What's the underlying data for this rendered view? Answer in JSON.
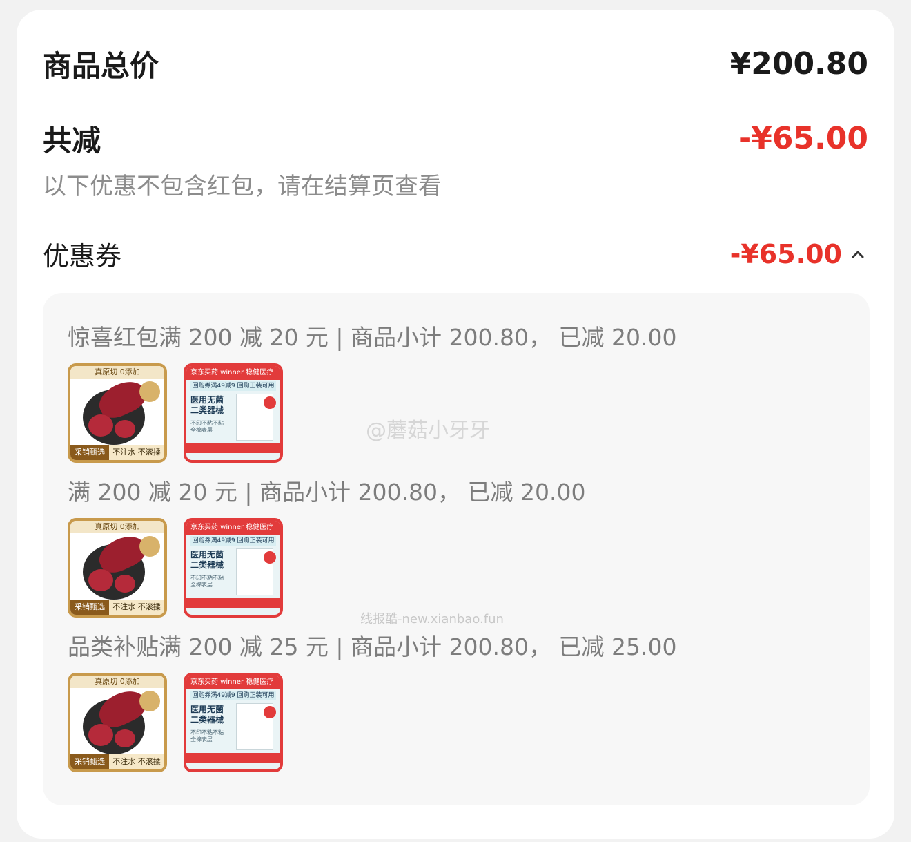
{
  "summary": {
    "total_label": "商品总价",
    "total_value": "¥200.80",
    "reduce_label": "共减",
    "reduce_value": "-¥65.00",
    "hint": "以下优惠不包含红包，请在结算页查看"
  },
  "coupon": {
    "label": "优惠券",
    "value": "-¥65.00",
    "expanded": true
  },
  "rules": [
    {
      "text": "惊喜红包满 200 减 20 元 | 商品小计 200.80， 已减 20.00"
    },
    {
      "text": "满 200 减 20 元 | 商品小计 200.80， 已减 20.00"
    },
    {
      "text": "品类补贴满 200 减 25 元 | 商品小计 200.80， 已减 25.00"
    }
  ],
  "thumb_beef": {
    "top": "真原切 0添加",
    "badge_left": "采销甄选",
    "badge_right": "不注水 不滚揉"
  },
  "thumb_pharm": {
    "header": "京东买药  winner 稳健医疗",
    "sub": "回购券满49减9 回购正装可用",
    "title_line1": "医用无菌",
    "title_line2": "二类器械",
    "small1": "不印不粘不粘",
    "small2": "全棉表层"
  },
  "watermark": {
    "weibo": "@蘑菇小牙牙",
    "site": "线报酷-new.xianbao.fun"
  },
  "colors": {
    "accent_red": "#e8322a",
    "background": "#f2f2f2"
  }
}
